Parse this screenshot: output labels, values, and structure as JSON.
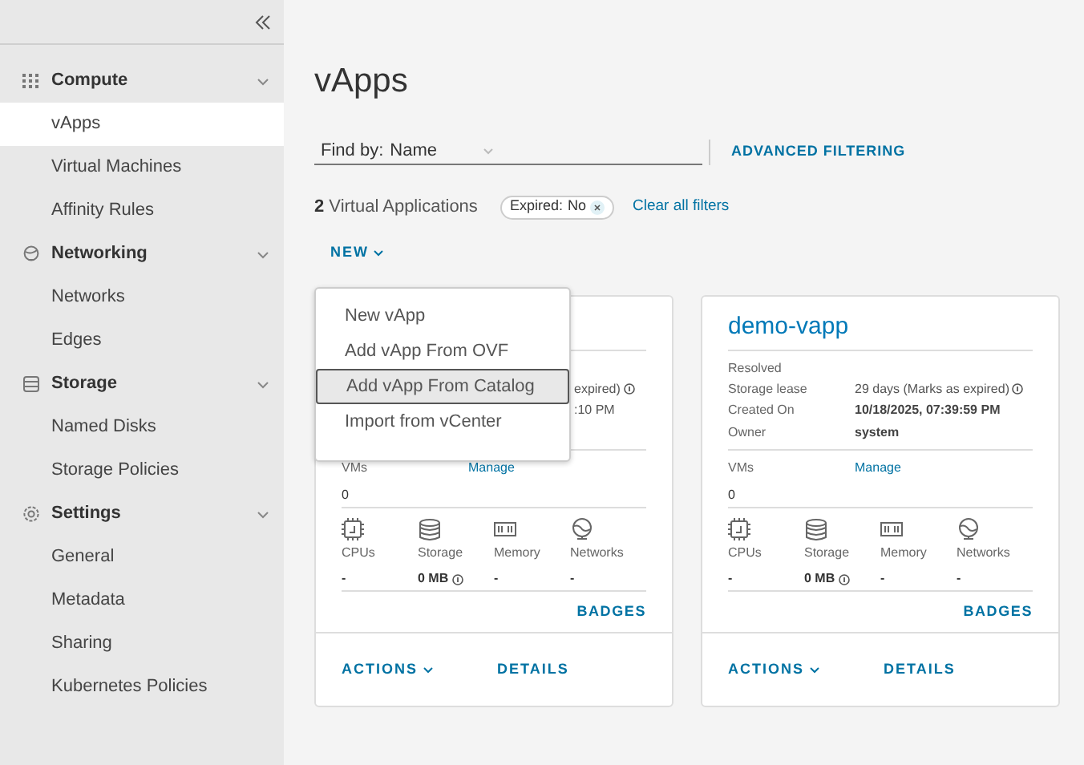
{
  "sidebar": {
    "sections": [
      {
        "label": "Compute",
        "expanded": true,
        "items": [
          {
            "label": "vApps",
            "selected": true
          },
          {
            "label": "Virtual Machines",
            "selected": false
          },
          {
            "label": "Affinity Rules",
            "selected": false
          }
        ]
      },
      {
        "label": "Networking",
        "expanded": true,
        "items": [
          {
            "label": "Networks",
            "selected": false
          },
          {
            "label": "Edges",
            "selected": false
          }
        ]
      },
      {
        "label": "Storage",
        "expanded": true,
        "items": [
          {
            "label": "Named Disks",
            "selected": false
          },
          {
            "label": "Storage Policies",
            "selected": false
          }
        ]
      },
      {
        "label": "Settings",
        "expanded": true,
        "items": [
          {
            "label": "General",
            "selected": false
          },
          {
            "label": "Metadata",
            "selected": false
          },
          {
            "label": "Sharing",
            "selected": false
          },
          {
            "label": "Kubernetes Policies",
            "selected": false
          }
        ]
      }
    ]
  },
  "page": {
    "title": "vApps"
  },
  "filter": {
    "label": "Find by:",
    "value": "Name"
  },
  "advanced_filtering": "ADVANCED FILTERING",
  "summary": {
    "count": "2",
    "label": "Virtual Applications"
  },
  "filter_chip": {
    "label": "Expired:",
    "value": "No"
  },
  "clear_filters": "Clear all filters",
  "new_button": {
    "label": "NEW",
    "expanded": true
  },
  "new_menu": [
    {
      "label": "New vApp",
      "selected": false
    },
    {
      "label": "Add vApp From OVF",
      "selected": false
    },
    {
      "label": "Add vApp From Catalog",
      "selected": true
    },
    {
      "label": "Import from vCenter",
      "selected": false
    }
  ],
  "cards": [
    {
      "fields": [
        {
          "kind": "cut",
          "value": "expired)",
          "info": true
        },
        {
          "kind": "cut",
          "value": ":10 PM"
        }
      ],
      "vms_label": "VMs",
      "vms_value": "0",
      "manage": "Manage",
      "resources": [
        {
          "label": "CPUs",
          "value": "-"
        },
        {
          "label": "Storage",
          "value": "0 MB",
          "info": true
        },
        {
          "label": "Memory",
          "value": "-"
        },
        {
          "label": "Networks",
          "value": "-"
        }
      ],
      "badges": "BADGES",
      "actions": "ACTIONS",
      "details": "DETAILS"
    },
    {
      "title": "demo-vapp",
      "status": "Resolved",
      "fields": [
        {
          "kind": "full",
          "label": "Storage lease",
          "value": "29 days (Marks as expired)",
          "info": true
        },
        {
          "kind": "full",
          "label": "Created On",
          "value": "10/18/2025, 07:39:59 PM",
          "bold": true
        },
        {
          "kind": "full",
          "label": "Owner",
          "value": "system",
          "bold": true
        }
      ],
      "vms_label": "VMs",
      "vms_value": "0",
      "manage": "Manage",
      "resources": [
        {
          "label": "CPUs",
          "value": "-"
        },
        {
          "label": "Storage",
          "value": "0 MB",
          "info": true
        },
        {
          "label": "Memory",
          "value": "-"
        },
        {
          "label": "Networks",
          "value": "-"
        }
      ],
      "badges": "BADGES",
      "actions": "ACTIONS",
      "details": "DETAILS"
    }
  ]
}
